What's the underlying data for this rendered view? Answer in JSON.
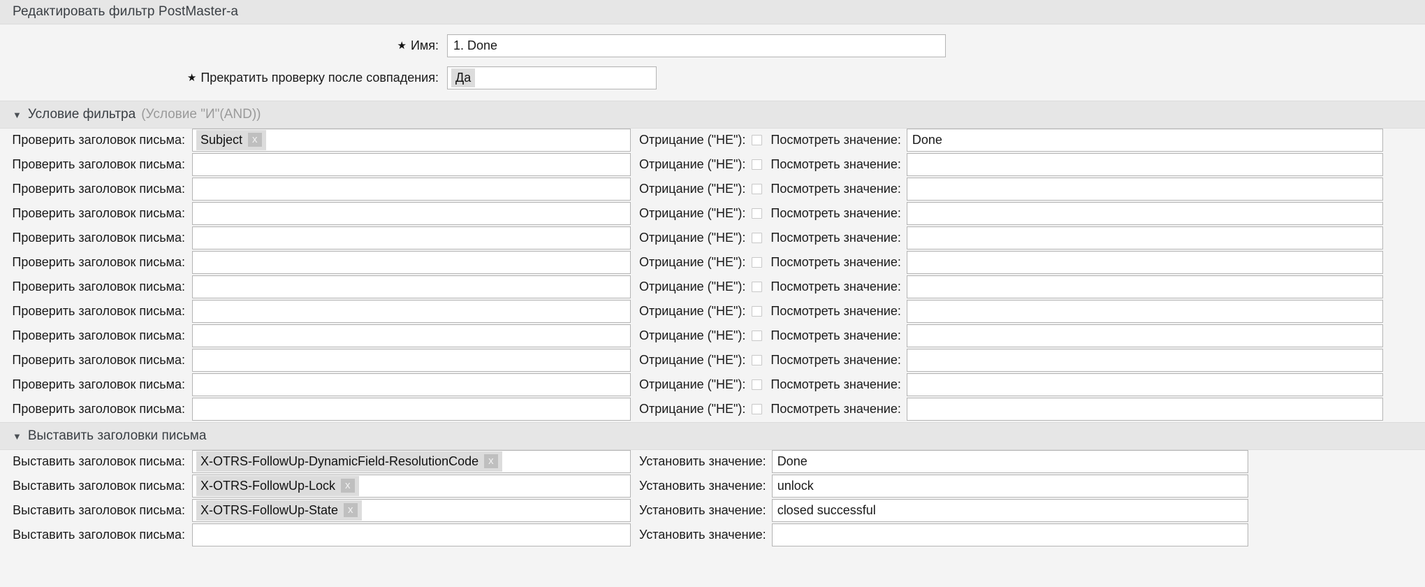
{
  "window": {
    "title": "Редактировать фильтр PostMaster-a"
  },
  "top_form": {
    "name_label": "Имя:",
    "name_value": "1. Done",
    "stop_label": "Прекратить проверку после совпадения:",
    "stop_value": "Да",
    "required_marker": "★"
  },
  "filter_section": {
    "caret": "▼",
    "title": "Условие фильтра",
    "subtitle": "(Условие \"И\"(AND))",
    "row_label": "Проверить заголовок письма:",
    "negate_label": "Отрицание (\"НЕ\"):",
    "value_label": "Посмотреть значение:",
    "rows": [
      {
        "header": "Subject",
        "has_chip": true,
        "negate": false,
        "value": "Done"
      },
      {
        "header": "",
        "has_chip": false,
        "negate": false,
        "value": ""
      },
      {
        "header": "",
        "has_chip": false,
        "negate": false,
        "value": ""
      },
      {
        "header": "",
        "has_chip": false,
        "negate": false,
        "value": ""
      },
      {
        "header": "",
        "has_chip": false,
        "negate": false,
        "value": ""
      },
      {
        "header": "",
        "has_chip": false,
        "negate": false,
        "value": ""
      },
      {
        "header": "",
        "has_chip": false,
        "negate": false,
        "value": ""
      },
      {
        "header": "",
        "has_chip": false,
        "negate": false,
        "value": ""
      },
      {
        "header": "",
        "has_chip": false,
        "negate": false,
        "value": ""
      },
      {
        "header": "",
        "has_chip": false,
        "negate": false,
        "value": ""
      },
      {
        "header": "",
        "has_chip": false,
        "negate": false,
        "value": ""
      },
      {
        "header": "",
        "has_chip": false,
        "negate": false,
        "value": ""
      }
    ]
  },
  "set_section": {
    "caret": "▼",
    "title": "Выставить заголовки письма",
    "row_label": "Выставить заголовок письма:",
    "value_label": "Установить значение:",
    "rows": [
      {
        "header": "X-OTRS-FollowUp-DynamicField-ResolutionCode",
        "has_chip": true,
        "value": "Done"
      },
      {
        "header": "X-OTRS-FollowUp-Lock",
        "has_chip": true,
        "value": "unlock"
      },
      {
        "header": "X-OTRS-FollowUp-State",
        "has_chip": true,
        "value": "closed successful"
      },
      {
        "header": "",
        "has_chip": false,
        "value": ""
      }
    ]
  },
  "chip_remove_label": "x"
}
